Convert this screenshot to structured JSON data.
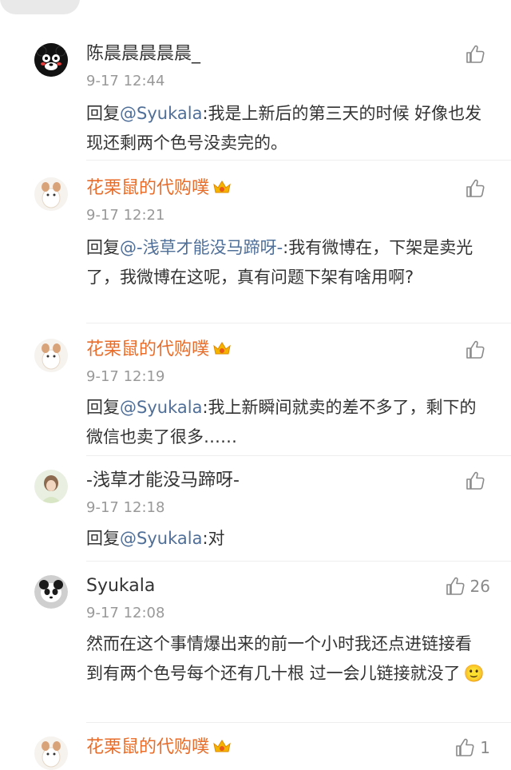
{
  "comments": [
    {
      "user": "陈晨晨晨晨晨_",
      "time": "9-17 12:44",
      "reply_prefix": "回复",
      "mention": "@Syukala",
      "body": ":我是上新后的第三天的时候 好像也发现还剩两个色号没卖完的。",
      "likes": ""
    },
    {
      "user": "花栗鼠的代购噗",
      "time": "9-17 12:21",
      "reply_prefix": "回复",
      "mention": "@-浅草才能没马蹄呀-",
      "body": ":我有微博在，下架是卖光了，我微博在这呢，真有问题下架有啥用啊?",
      "likes": ""
    },
    {
      "user": "花栗鼠的代购噗",
      "time": "9-17 12:19",
      "reply_prefix": "回复",
      "mention": "@Syukala",
      "body": ":我上新瞬间就卖的差不多了，剩下的微信也卖了很多……",
      "likes": ""
    },
    {
      "user": "-浅草才能没马蹄呀-",
      "time": "9-17 12:18",
      "reply_prefix": "回复",
      "mention": "@Syukala",
      "body": ":对",
      "likes": ""
    },
    {
      "user": "Syukala",
      "time": "9-17 12:08",
      "body": "然而在这个事情爆出来的前一个小时我还点进链接看到有两个色号每个还有几十根 过一会儿链接就没了",
      "emoji": "🙂",
      "likes": "26"
    },
    {
      "user": "花栗鼠的代购噗",
      "time": "",
      "likes": "1"
    }
  ],
  "colors": {
    "accent_name": "#e86d2a",
    "mention": "#4f6f99",
    "meta": "#999999"
  },
  "icons": {
    "like": "thumbs-up-icon",
    "vip": "vip-crown-icon"
  }
}
